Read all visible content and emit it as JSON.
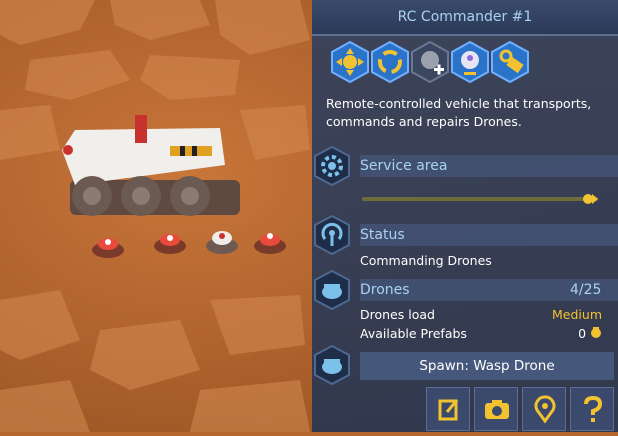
{
  "panel": {
    "title": "RC Commander #1",
    "description": "Remote-controlled vehicle that transports, commands and repairs Drones.",
    "abilities": [
      {
        "icon": "move-icon"
      },
      {
        "icon": "recharge-icon"
      },
      {
        "icon": "unload-drones-icon"
      },
      {
        "icon": "load-drones-icon"
      },
      {
        "icon": "convert-prefab-icon"
      }
    ],
    "service_area": {
      "label": "Service area",
      "level": 0.97
    },
    "status": {
      "label": "Status",
      "value": "Commanding Drones"
    },
    "drones": {
      "label": "Drones",
      "count": "4/25",
      "load_label": "Drones load",
      "load_value": "Medium",
      "prefabs_label": "Available Prefabs",
      "prefabs_value": "0"
    },
    "spawn_label": "Spawn: Wasp Drone",
    "tools": [
      {
        "icon": "rename-icon"
      },
      {
        "icon": "camera-icon"
      },
      {
        "icon": "locate-icon"
      },
      {
        "icon": "help-icon"
      }
    ]
  },
  "colors": {
    "accent": "#a9d2f2",
    "highlight": "#f2c230",
    "panel": "#34425e"
  }
}
